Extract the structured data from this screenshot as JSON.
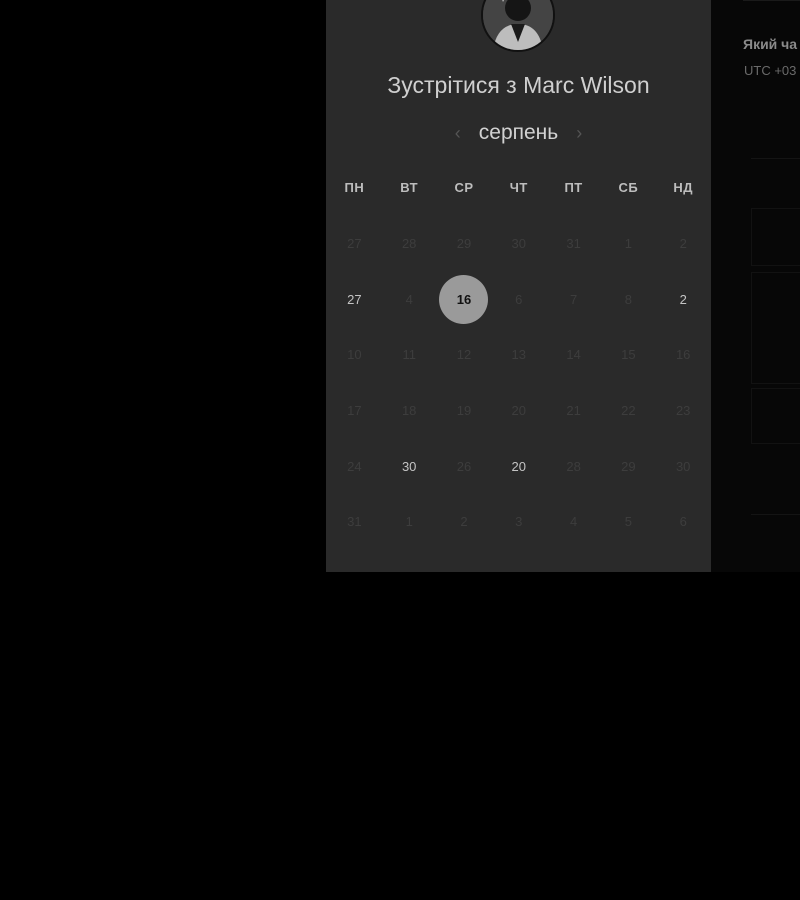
{
  "meeting": {
    "title": "Зустрітися з Marc Wilson",
    "avatar_icon": "user-avatar"
  },
  "calendar": {
    "month": "серпень",
    "prev_icon": "chevron-left-icon",
    "next_icon": "chevron-right-icon",
    "weekdays": [
      "ПН",
      "ВТ",
      "СР",
      "ЧТ",
      "ПТ",
      "СБ",
      "НД"
    ],
    "weeks": [
      [
        {
          "label": "27",
          "state": "muted"
        },
        {
          "label": "28",
          "state": "muted"
        },
        {
          "label": "29",
          "state": "muted"
        },
        {
          "label": "30",
          "state": "muted"
        },
        {
          "label": "31",
          "state": "muted"
        },
        {
          "label": "1",
          "state": "muted"
        },
        {
          "label": "2",
          "state": "muted"
        }
      ],
      [
        {
          "label": "27",
          "state": "active"
        },
        {
          "label": "4",
          "state": "muted"
        },
        {
          "label": "16",
          "state": "selected"
        },
        {
          "label": "6",
          "state": "muted"
        },
        {
          "label": "7",
          "state": "muted"
        },
        {
          "label": "8",
          "state": "muted"
        },
        {
          "label": "2",
          "state": "active"
        }
      ],
      [
        {
          "label": "10",
          "state": "muted"
        },
        {
          "label": "11",
          "state": "muted"
        },
        {
          "label": "12",
          "state": "muted"
        },
        {
          "label": "13",
          "state": "muted"
        },
        {
          "label": "14",
          "state": "muted"
        },
        {
          "label": "15",
          "state": "muted"
        },
        {
          "label": "16",
          "state": "muted"
        }
      ],
      [
        {
          "label": "17",
          "state": "muted"
        },
        {
          "label": "18",
          "state": "muted"
        },
        {
          "label": "19",
          "state": "muted"
        },
        {
          "label": "20",
          "state": "muted"
        },
        {
          "label": "21",
          "state": "muted"
        },
        {
          "label": "22",
          "state": "muted"
        },
        {
          "label": "23",
          "state": "muted"
        }
      ],
      [
        {
          "label": "24",
          "state": "muted"
        },
        {
          "label": "30",
          "state": "active"
        },
        {
          "label": "26",
          "state": "muted"
        },
        {
          "label": "20",
          "state": "active"
        },
        {
          "label": "28",
          "state": "muted"
        },
        {
          "label": "29",
          "state": "muted"
        },
        {
          "label": "30",
          "state": "muted"
        }
      ],
      [
        {
          "label": "31",
          "state": "muted"
        },
        {
          "label": "1",
          "state": "muted"
        },
        {
          "label": "2",
          "state": "muted"
        },
        {
          "label": "3",
          "state": "muted"
        },
        {
          "label": "4",
          "state": "muted"
        },
        {
          "label": "5",
          "state": "muted"
        },
        {
          "label": "6",
          "state": "muted"
        }
      ]
    ]
  },
  "side_panel": {
    "title": "Який ча",
    "timezone": "UTC +03"
  },
  "colors": {
    "card_background": "#2a2a2a",
    "selected_day": "#9a9a9a",
    "page_background": "#000000"
  }
}
